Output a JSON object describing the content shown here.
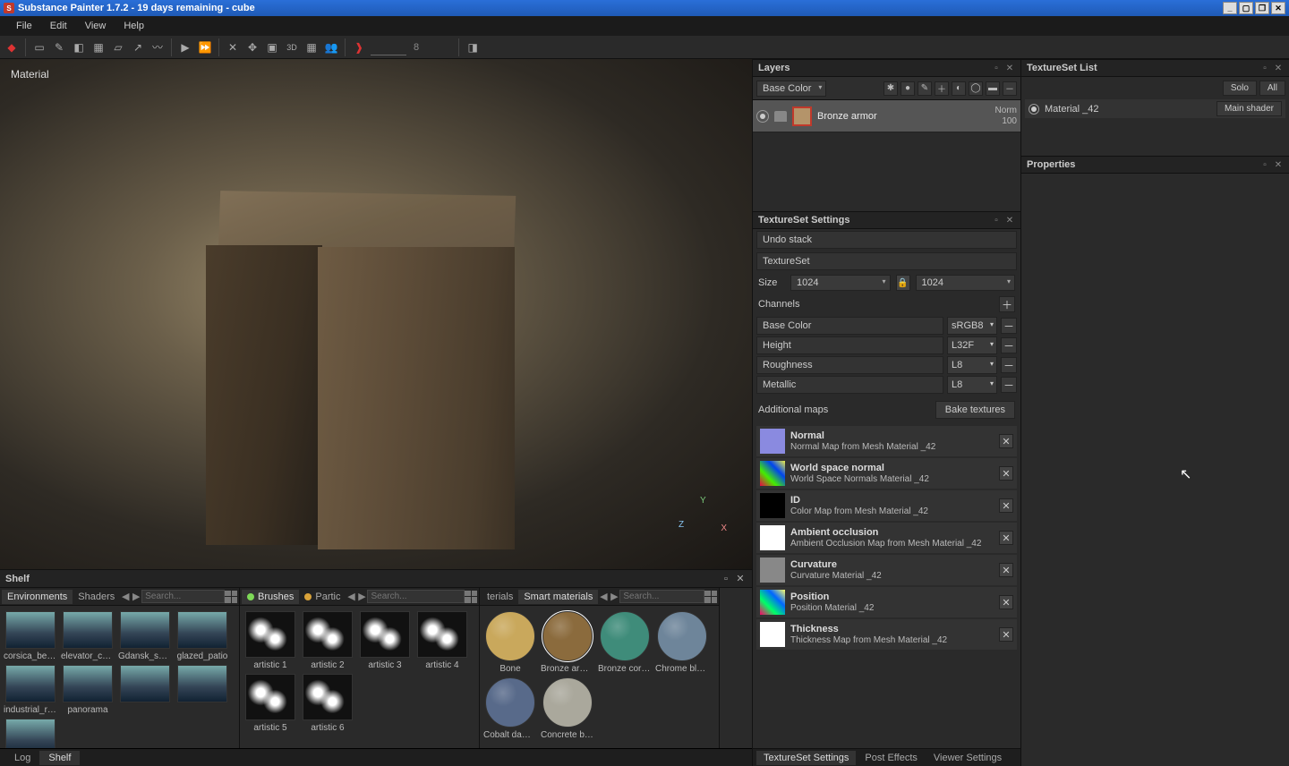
{
  "title": "Substance Painter 1.7.2 - 19 days remaining - cube",
  "menubar": [
    "File",
    "Edit",
    "View",
    "Help"
  ],
  "toolbar_number": "8",
  "viewport": {
    "label": "Material",
    "axes": {
      "y": "Y",
      "x": "X",
      "z": "Z"
    }
  },
  "shelf": {
    "header": "Shelf",
    "footer_tabs": [
      "Log",
      "Shelf"
    ],
    "footer_active": "Shelf",
    "cols": [
      {
        "tabs": [
          {
            "label": "Environments",
            "active": true
          },
          {
            "label": "Shaders",
            "active": false
          }
        ],
        "search": "Search...",
        "items": [
          "corsica_beach",
          "elevator_corr...",
          "Gdansk_ship...",
          "glazed_patio",
          "industrial_room",
          "panorama",
          "",
          "",
          ""
        ]
      },
      {
        "tabs": [
          {
            "label": "Brushes",
            "led": "#7ed957",
            "active": true
          },
          {
            "label": "Partic",
            "led": "#d9a33a",
            "active": false
          }
        ],
        "search": "Search...",
        "items": [
          "artistic 1",
          "artistic 2",
          "artistic 3",
          "artistic 4",
          "artistic 5",
          "artistic 6"
        ]
      },
      {
        "tabs": [
          {
            "label": "terials",
            "active": false
          },
          {
            "label": "Smart materials",
            "active": true
          }
        ],
        "search": "Search...",
        "items": [
          "Bone",
          "Bronze armor",
          "Bronze corro...",
          "Chrome blue...",
          "Cobalt dama...",
          "Concrete bare"
        ],
        "sel_index": 1,
        "ball_colors": [
          "#c9a85c",
          "#8b6b3d",
          "#3f8c7a",
          "#6e859a",
          "#586a8a",
          "#aaa89c"
        ]
      }
    ]
  },
  "layers": {
    "header": "Layers",
    "channel_dd": "Base Color",
    "layer": {
      "name": "Bronze armor",
      "mode": "Norm",
      "opacity": "100"
    }
  },
  "ts": {
    "header": "TextureSet Settings",
    "undo": "Undo stack",
    "tset": "TextureSet",
    "size_label": "Size",
    "size": "1024",
    "size2": "1024",
    "channels_label": "Channels",
    "channels": [
      {
        "name": "Base Color",
        "fmt": "sRGB8"
      },
      {
        "name": "Height",
        "fmt": "L32F"
      },
      {
        "name": "Roughness",
        "fmt": "L8"
      },
      {
        "name": "Metallic",
        "fmt": "L8"
      }
    ],
    "addl": "Additional maps",
    "bake": "Bake textures",
    "maps": [
      {
        "title": "Normal",
        "sub": "Normal Map from Mesh Material _42",
        "color": "#8a8ae0"
      },
      {
        "title": "World space normal",
        "sub": "World Space Normals Material _42",
        "color": "linear-gradient(45deg,#e04,#4e0,#04e,#ee4)",
        "multi": true
      },
      {
        "title": "ID",
        "sub": "Color Map from Mesh Material _42",
        "color": "#000"
      },
      {
        "title": "Ambient occlusion",
        "sub": "Ambient Occlusion Map from Mesh Material _42",
        "color": "#fff"
      },
      {
        "title": "Curvature",
        "sub": "Curvature Material _42",
        "color": "#888"
      },
      {
        "title": "Position",
        "sub": "Position Material _42",
        "color": "linear-gradient(45deg,#f06,#0f6,#06f,#ff6)",
        "multi": true
      },
      {
        "title": "Thickness",
        "sub": "Thickness Map from Mesh Material _42",
        "color": "#fff"
      }
    ],
    "right_tabs": [
      "TextureSet Settings",
      "Post Effects",
      "Viewer Settings"
    ]
  },
  "tsl": {
    "header": "TextureSet List",
    "solo": "Solo",
    "all": "All",
    "item": "Material _42",
    "shader": "Main shader"
  },
  "props": {
    "header": "Properties"
  }
}
